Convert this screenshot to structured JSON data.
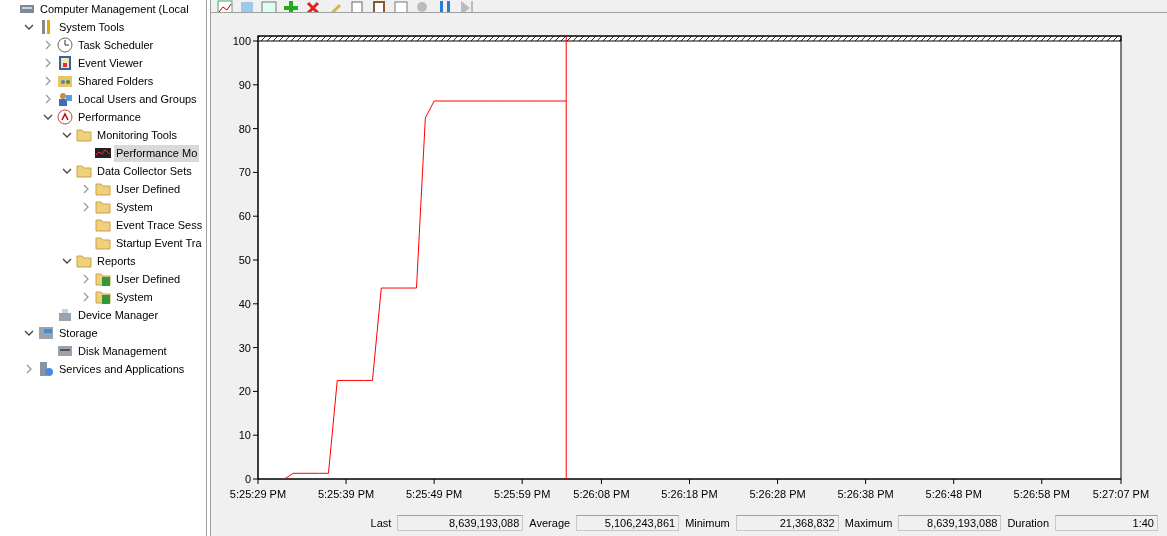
{
  "tree": [
    {
      "label": "Computer Management (Local",
      "kind": "computer",
      "selected": false,
      "children": [
        {
          "label": "System Tools",
          "kind": "tools",
          "expanded": true,
          "selected": false,
          "children": [
            {
              "label": "Task Scheduler",
              "kind": "clock",
              "expanded": false,
              "selected": false
            },
            {
              "label": "Event Viewer",
              "kind": "log",
              "expanded": false,
              "selected": false
            },
            {
              "label": "Shared Folders",
              "kind": "share",
              "expanded": false,
              "selected": false
            },
            {
              "label": "Local Users and Groups",
              "kind": "users",
              "expanded": false,
              "selected": false
            },
            {
              "label": "Performance",
              "kind": "gauge",
              "expanded": true,
              "selected": false,
              "children": [
                {
                  "label": "Monitoring Tools",
                  "kind": "folder",
                  "expanded": true,
                  "selected": false,
                  "children": [
                    {
                      "label": "Performance Mo",
                      "kind": "monitor",
                      "selected": true
                    }
                  ]
                },
                {
                  "label": "Data Collector Sets",
                  "kind": "folder",
                  "expanded": true,
                  "selected": false,
                  "children": [
                    {
                      "label": "User Defined",
                      "kind": "folder",
                      "expanded": false,
                      "selected": false
                    },
                    {
                      "label": "System",
                      "kind": "folder",
                      "expanded": false,
                      "selected": false
                    },
                    {
                      "label": "Event Trace Sess",
                      "kind": "folder",
                      "selected": false
                    },
                    {
                      "label": "Startup Event Tra",
                      "kind": "folder",
                      "selected": false
                    }
                  ]
                },
                {
                  "label": "Reports",
                  "kind": "folder",
                  "expanded": true,
                  "selected": false,
                  "children": [
                    {
                      "label": "User Defined",
                      "kind": "report",
                      "expanded": false,
                      "selected": false
                    },
                    {
                      "label": "System",
                      "kind": "report",
                      "expanded": false,
                      "selected": false
                    }
                  ]
                }
              ]
            },
            {
              "label": "Device Manager",
              "kind": "device",
              "selected": false
            }
          ]
        },
        {
          "label": "Storage",
          "kind": "storage",
          "expanded": true,
          "selected": false,
          "children": [
            {
              "label": "Disk Management",
              "kind": "disk",
              "selected": false
            }
          ]
        },
        {
          "label": "Services and Applications",
          "kind": "services",
          "expanded": false,
          "selected": false
        }
      ]
    }
  ],
  "chart_data": {
    "type": "line",
    "categories": [
      "5:25:29 PM",
      null,
      null,
      null,
      null,
      null,
      null,
      null,
      null,
      null,
      "5:25:39 PM",
      null,
      null,
      null,
      null,
      null,
      null,
      null,
      null,
      null,
      "5:25:49 PM",
      null,
      null,
      null,
      null,
      null,
      null,
      null,
      null,
      null,
      "5:25:59 PM",
      null,
      null,
      null,
      null,
      null,
      null,
      null,
      null,
      "5:26:08 PM",
      null,
      null,
      null,
      null,
      null,
      null,
      null,
      null,
      null,
      "5:26:18 PM",
      null,
      null,
      null,
      null,
      null,
      null,
      null,
      null,
      null,
      "5:26:28 PM",
      null,
      null,
      null,
      null,
      null,
      null,
      null,
      null,
      null,
      "5:26:38 PM",
      null,
      null,
      null,
      null,
      null,
      null,
      null,
      null,
      null,
      "5:26:48 PM",
      null,
      null,
      null,
      null,
      null,
      null,
      null,
      null,
      null,
      "5:26:58 PM",
      null,
      null,
      null,
      null,
      null,
      null,
      null,
      null,
      "5:27:07 PM"
    ],
    "series": [
      {
        "color": "#ff0000",
        "values": [
          null,
          null,
          null,
          0,
          1.3,
          1.3,
          1.3,
          1.3,
          1.3,
          22.5,
          22.5,
          22.5,
          22.5,
          22.5,
          43.6,
          43.6,
          43.6,
          43.6,
          43.6,
          82.4,
          86.3,
          86.3,
          86.3,
          86.3,
          86.3,
          86.3,
          86.3,
          86.3,
          86.3,
          86.3,
          86.3,
          86.3,
          86.3,
          86.3,
          86.3,
          86.3,
          null,
          null,
          null,
          null,
          null,
          null,
          null,
          null,
          null,
          null,
          null,
          null,
          null,
          null,
          null,
          null,
          null,
          null,
          null,
          null,
          null,
          null,
          null,
          null,
          null,
          null,
          null,
          null,
          null,
          null,
          null,
          null,
          null,
          null,
          null,
          null,
          null,
          null,
          null,
          null,
          null,
          null,
          null,
          null,
          null,
          null,
          null,
          null,
          null,
          null,
          null,
          null,
          null,
          null,
          null,
          null,
          null,
          null,
          null,
          null,
          null,
          null,
          null
        ]
      }
    ],
    "ylim": [
      0,
      100
    ],
    "yticks": [
      0,
      10,
      20,
      30,
      40,
      50,
      60,
      70,
      80,
      90,
      100
    ]
  },
  "stats": [
    {
      "label": "Last",
      "value": "8,639,193,088"
    },
    {
      "label": "Average",
      "value": "5,106,243,861"
    },
    {
      "label": "Minimum",
      "value": "21,368,832"
    },
    {
      "label": "Maximum",
      "value": "8,639,193,088"
    },
    {
      "label": "Duration",
      "value": "1:40"
    }
  ]
}
